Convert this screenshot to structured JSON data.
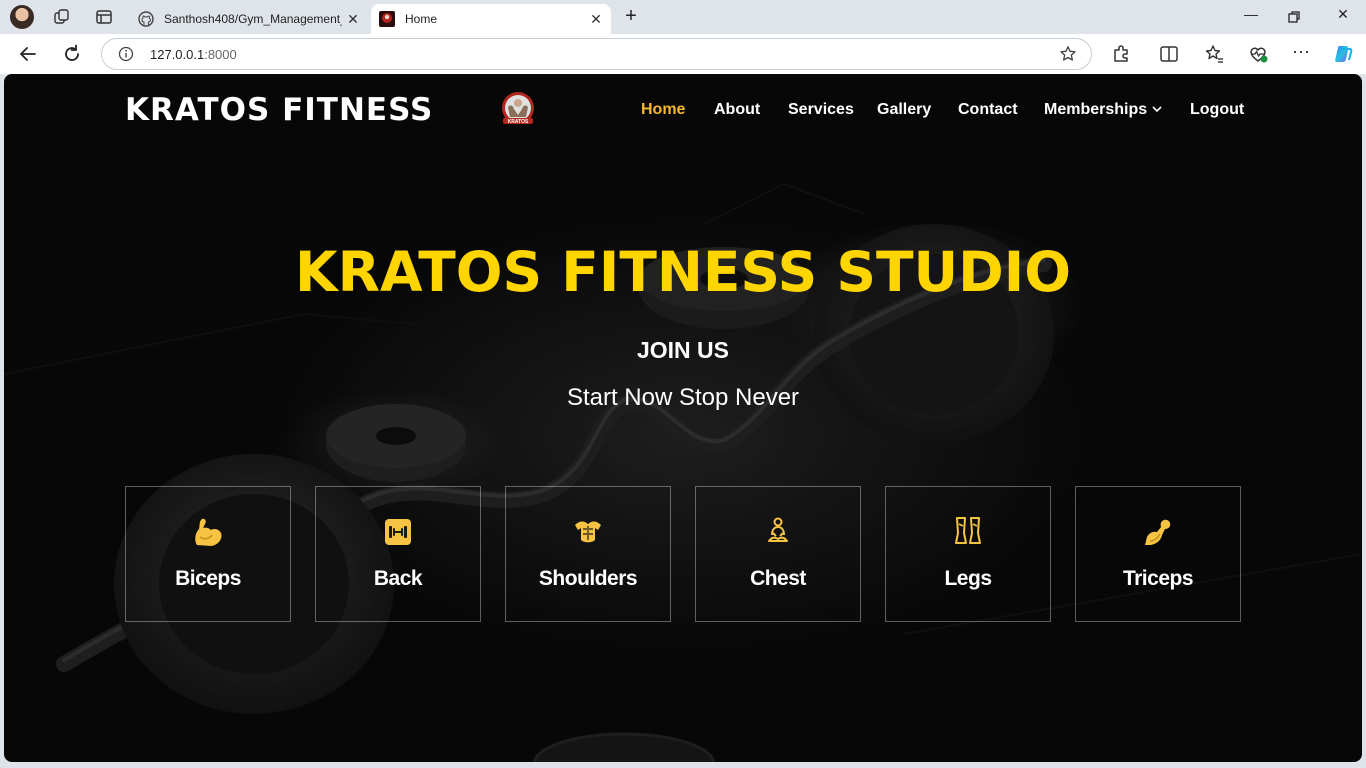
{
  "browser": {
    "tabs": [
      {
        "title": "Santhosh408/Gym_Management_",
        "active": false
      },
      {
        "title": "Home",
        "active": true
      }
    ],
    "url_host": "127.0.0.1",
    "url_port": ":8000",
    "icons": [
      "profile-avatar",
      "workspaces-icon",
      "tab-actions-icon",
      "github-icon",
      "close-icon",
      "new-tab-icon",
      "minimize-icon",
      "restore-icon",
      "back-icon",
      "refresh-icon",
      "info-icon",
      "star-icon",
      "extensions-icon",
      "split-screen-icon",
      "favorites-icon",
      "browser-essentials-icon",
      "more-icon",
      "copilot-icon"
    ]
  },
  "site": {
    "brand": "KRATOS FITNESS",
    "logo_text": "KRATOS",
    "nav": [
      {
        "label": "Home",
        "active": true
      },
      {
        "label": "About"
      },
      {
        "label": "Services"
      },
      {
        "label": "Gallery"
      },
      {
        "label": "Contact"
      },
      {
        "label": "Memberships",
        "dropdown": true
      },
      {
        "label": "Logout"
      }
    ],
    "accent_color": "#f5b82e",
    "title_color": "#ffd500"
  },
  "hero": {
    "title": "KRATOS FITNESS STUDIO",
    "subtitle": "JOIN US",
    "tagline": "Start Now Stop Never"
  },
  "categories": [
    {
      "label": "Biceps",
      "icon": "flexed-arm-icon"
    },
    {
      "label": "Back",
      "icon": "dumbbell-icon"
    },
    {
      "label": "Shoulders",
      "icon": "torso-icon"
    },
    {
      "label": "Chest",
      "icon": "meditating-person-icon"
    },
    {
      "label": "Legs",
      "icon": "legs-icon"
    },
    {
      "label": "Triceps",
      "icon": "strong-arm-icon"
    }
  ]
}
